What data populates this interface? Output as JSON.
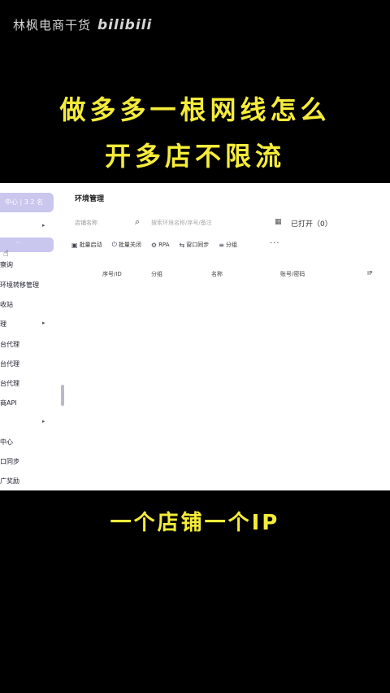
{
  "watermark": {
    "channel": "林枫电商干货",
    "platform": "bilibili"
  },
  "headline": {
    "line1": "做多多一根网线怎么",
    "line2": "开多店不限流"
  },
  "caption": "一个店铺一个IP",
  "app": {
    "sidebar": {
      "top_label": "中心 | 3 2 名",
      "items": [
        {
          "label": "",
          "arrow": "▸"
        },
        {
          "label": "",
          "active": true,
          "dots": "··"
        },
        {
          "label": "察询"
        },
        {
          "label": "环境转移管理"
        },
        {
          "label": "收站"
        },
        {
          "label": "理",
          "arrow": "▸"
        },
        {
          "label": "台代理"
        },
        {
          "label": "台代理"
        },
        {
          "label": "台代理"
        },
        {
          "label": "商API"
        },
        {
          "label": "",
          "arrow": "▸"
        },
        {
          "label": "中心"
        },
        {
          "label": "口同步"
        },
        {
          "label": "广奖励"
        }
      ]
    },
    "main": {
      "title": "环境管理",
      "filter_placeholder": "店铺名称",
      "search_placeholder": "搜索环境名称/序号/备注",
      "opened_label": "已打开（0）",
      "toolbar": [
        {
          "icon": "batch-open-icon",
          "glyph": "▣",
          "label": "批量启动"
        },
        {
          "icon": "power-icon",
          "glyph": "⏻",
          "label": "批量关闭"
        },
        {
          "icon": "rpa-icon",
          "glyph": "⚙",
          "label": "RPA"
        },
        {
          "icon": "sync-icon",
          "glyph": "⇆",
          "label": "窗口同步"
        },
        {
          "icon": "group-icon",
          "glyph": "⋮≡",
          "label": "分组"
        }
      ],
      "more_label": "···",
      "columns": [
        "序号/ID",
        "分组",
        "名称",
        "账号/密码",
        "IP"
      ]
    }
  }
}
